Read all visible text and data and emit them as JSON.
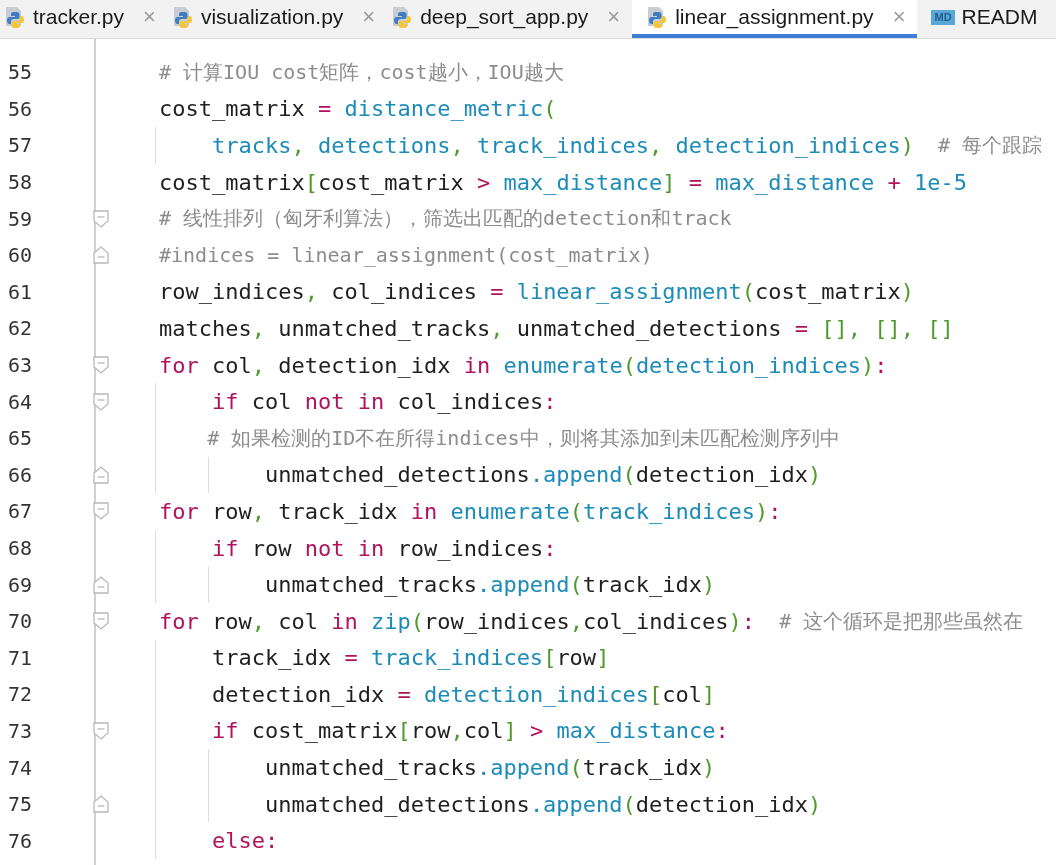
{
  "tabs": [
    {
      "label": "tracker.py",
      "kind": "python",
      "close": "×",
      "selected": false
    },
    {
      "label": "visualization.py",
      "kind": "python",
      "close": "×",
      "selected": false
    },
    {
      "label": "deep_sort_app.py",
      "kind": "python",
      "close": "×",
      "selected": false
    },
    {
      "label": "linear_assignment.py",
      "kind": "python",
      "close": "×",
      "selected": true
    },
    {
      "label": "READM",
      "kind": "markdown",
      "badge": "MD",
      "selected": false
    }
  ],
  "lines": [
    {
      "number": "55",
      "fold_start": false,
      "fold_end": false,
      "code": [
        {
          "text": "# 计算IOU cost矩阵，cost越小，IOU越大",
          "kind": "comment"
        }
      ]
    },
    {
      "number": "56",
      "fold_start": false,
      "fold_end": false,
      "code": [
        {
          "text": "cost_matrix "
        },
        {
          "text": "=",
          "kind": "op"
        },
        {
          "text": " distance_metric",
          "kind": "name"
        },
        {
          "text": "(",
          "kind": "punct"
        }
      ]
    },
    {
      "number": "57",
      "fold_start": false,
      "fold_end": false,
      "code": [
        {
          "text": "    tracks",
          "kind": "name"
        },
        {
          "text": ",",
          "kind": "punct"
        },
        {
          "text": " detections",
          "kind": "name"
        },
        {
          "text": ",",
          "kind": "punct"
        },
        {
          "text": " track_indices",
          "kind": "name"
        },
        {
          "text": ",",
          "kind": "punct"
        },
        {
          "text": " detection_indices",
          "kind": "name"
        },
        {
          "text": ")",
          "kind": "punct"
        },
        {
          "text": "  # 每个跟踪",
          "kind": "comment"
        }
      ]
    },
    {
      "number": "58",
      "fold_start": false,
      "fold_end": false,
      "code": [
        {
          "text": "cost_matrix"
        },
        {
          "text": "[",
          "kind": "punct"
        },
        {
          "text": "cost_matrix "
        },
        {
          "text": ">",
          "kind": "op"
        },
        {
          "text": " max_distance",
          "kind": "name"
        },
        {
          "text": "]",
          "kind": "punct"
        },
        {
          "text": " =",
          "kind": "op"
        },
        {
          "text": " max_distance ",
          "kind": "name"
        },
        {
          "text": "+",
          "kind": "op"
        },
        {
          "text": " 1e-5",
          "kind": "name"
        }
      ]
    },
    {
      "number": "59",
      "fold_start": true,
      "fold_end": false,
      "code": [
        {
          "text": "# 线性排列（匈牙利算法），筛选出匹配的detection和track",
          "kind": "comment"
        }
      ]
    },
    {
      "number": "60",
      "fold_start": false,
      "fold_end": true,
      "code": [
        {
          "text": "#indices = linear_assignment(cost_matrix)",
          "kind": "comment"
        }
      ]
    },
    {
      "number": "61",
      "fold_start": false,
      "fold_end": false,
      "code": [
        {
          "text": "row_indices"
        },
        {
          "text": ",",
          "kind": "punct"
        },
        {
          "text": " col_indices "
        },
        {
          "text": "=",
          "kind": "op"
        },
        {
          "text": " linear_assignment",
          "kind": "name"
        },
        {
          "text": "(",
          "kind": "punct"
        },
        {
          "text": "cost_matrix"
        },
        {
          "text": ")",
          "kind": "punct"
        }
      ]
    },
    {
      "number": "62",
      "fold_start": false,
      "fold_end": false,
      "code": [
        {
          "text": "matches"
        },
        {
          "text": ",",
          "kind": "punct"
        },
        {
          "text": " unmatched_tracks"
        },
        {
          "text": ",",
          "kind": "punct"
        },
        {
          "text": " unmatched_detections "
        },
        {
          "text": "=",
          "kind": "op"
        },
        {
          "text": " [], [], []",
          "kind": "punct"
        }
      ]
    },
    {
      "number": "63",
      "fold_start": true,
      "fold_end": false,
      "code": [
        {
          "text": "for",
          "kind": "keyword"
        },
        {
          "text": " col"
        },
        {
          "text": ",",
          "kind": "punct"
        },
        {
          "text": " detection_idx "
        },
        {
          "text": "in",
          "kind": "keyword"
        },
        {
          "text": " enumerate",
          "kind": "name"
        },
        {
          "text": "(",
          "kind": "punct"
        },
        {
          "text": "detection_indices",
          "kind": "name"
        },
        {
          "text": ")",
          "kind": "punct"
        },
        {
          "text": ":",
          "kind": "op"
        }
      ]
    },
    {
      "number": "64",
      "fold_start": true,
      "fold_end": false,
      "code": [
        {
          "text": "    if",
          "kind": "keyword"
        },
        {
          "text": " col "
        },
        {
          "text": "not in",
          "kind": "keyword"
        },
        {
          "text": " col_indices"
        },
        {
          "text": ":",
          "kind": "op"
        }
      ]
    },
    {
      "number": "65",
      "fold_start": false,
      "fold_end": false,
      "code": [
        {
          "text": "    # 如果检测的ID不在所得indices中，则将其添加到未匹配检测序列中",
          "kind": "comment"
        }
      ]
    },
    {
      "number": "66",
      "fold_start": false,
      "fold_end": true,
      "code": [
        {
          "text": "        unmatched_detections"
        },
        {
          "text": ".append",
          "kind": "name"
        },
        {
          "text": "(",
          "kind": "punct"
        },
        {
          "text": "detection_idx"
        },
        {
          "text": ")",
          "kind": "punct"
        }
      ]
    },
    {
      "number": "67",
      "fold_start": true,
      "fold_end": false,
      "code": [
        {
          "text": "for",
          "kind": "keyword"
        },
        {
          "text": " row"
        },
        {
          "text": ",",
          "kind": "punct"
        },
        {
          "text": " track_idx "
        },
        {
          "text": "in",
          "kind": "keyword"
        },
        {
          "text": " enumerate",
          "kind": "name"
        },
        {
          "text": "(",
          "kind": "punct"
        },
        {
          "text": "track_indices",
          "kind": "name"
        },
        {
          "text": ")",
          "kind": "punct"
        },
        {
          "text": ":",
          "kind": "op"
        }
      ]
    },
    {
      "number": "68",
      "fold_start": false,
      "fold_end": false,
      "code": [
        {
          "text": "    if",
          "kind": "keyword"
        },
        {
          "text": " row "
        },
        {
          "text": "not in",
          "kind": "keyword"
        },
        {
          "text": " row_indices"
        },
        {
          "text": ":",
          "kind": "op"
        }
      ]
    },
    {
      "number": "69",
      "fold_start": false,
      "fold_end": true,
      "code": [
        {
          "text": "        unmatched_tracks"
        },
        {
          "text": ".append",
          "kind": "name"
        },
        {
          "text": "(",
          "kind": "punct"
        },
        {
          "text": "track_idx"
        },
        {
          "text": ")",
          "kind": "punct"
        }
      ]
    },
    {
      "number": "70",
      "fold_start": true,
      "fold_end": false,
      "code": [
        {
          "text": "for",
          "kind": "keyword"
        },
        {
          "text": " row"
        },
        {
          "text": ",",
          "kind": "punct"
        },
        {
          "text": " col "
        },
        {
          "text": "in",
          "kind": "keyword"
        },
        {
          "text": " zip",
          "kind": "name"
        },
        {
          "text": "(",
          "kind": "punct"
        },
        {
          "text": "row_indices"
        },
        {
          "text": ",",
          "kind": "punct"
        },
        {
          "text": "col_indices"
        },
        {
          "text": ")",
          "kind": "punct"
        },
        {
          "text": ":",
          "kind": "op"
        },
        {
          "text": "  # 这个循环是把那些虽然在",
          "kind": "comment"
        }
      ]
    },
    {
      "number": "71",
      "fold_start": false,
      "fold_end": false,
      "code": [
        {
          "text": "    track_idx "
        },
        {
          "text": "=",
          "kind": "op"
        },
        {
          "text": " track_indices",
          "kind": "name"
        },
        {
          "text": "[",
          "kind": "punct"
        },
        {
          "text": "row"
        },
        {
          "text": "]",
          "kind": "punct"
        }
      ]
    },
    {
      "number": "72",
      "fold_start": false,
      "fold_end": false,
      "code": [
        {
          "text": "    detection_idx "
        },
        {
          "text": "=",
          "kind": "op"
        },
        {
          "text": " detection_indices",
          "kind": "name"
        },
        {
          "text": "[",
          "kind": "punct"
        },
        {
          "text": "col"
        },
        {
          "text": "]",
          "kind": "punct"
        }
      ]
    },
    {
      "number": "73",
      "fold_start": true,
      "fold_end": false,
      "code": [
        {
          "text": "    if",
          "kind": "keyword"
        },
        {
          "text": " cost_matrix"
        },
        {
          "text": "[",
          "kind": "punct"
        },
        {
          "text": "row"
        },
        {
          "text": ",",
          "kind": "punct"
        },
        {
          "text": "col"
        },
        {
          "text": "]",
          "kind": "punct"
        },
        {
          "text": " >",
          "kind": "op"
        },
        {
          "text": " max_distance",
          "kind": "name"
        },
        {
          "text": ":",
          "kind": "op"
        }
      ]
    },
    {
      "number": "74",
      "fold_start": false,
      "fold_end": false,
      "code": [
        {
          "text": "        unmatched_tracks"
        },
        {
          "text": ".append",
          "kind": "name"
        },
        {
          "text": "(",
          "kind": "punct"
        },
        {
          "text": "track_idx"
        },
        {
          "text": ")",
          "kind": "punct"
        }
      ]
    },
    {
      "number": "75",
      "fold_start": false,
      "fold_end": true,
      "code": [
        {
          "text": "        unmatched_detections"
        },
        {
          "text": ".append",
          "kind": "name"
        },
        {
          "text": "(",
          "kind": "punct"
        },
        {
          "text": "detection_idx"
        },
        {
          "text": ")",
          "kind": "punct"
        }
      ]
    },
    {
      "number": "76",
      "fold_start": false,
      "fold_end": false,
      "code": [
        {
          "text": "    else",
          "kind": "keyword"
        },
        {
          "text": ":",
          "kind": "op"
        }
      ]
    }
  ]
}
